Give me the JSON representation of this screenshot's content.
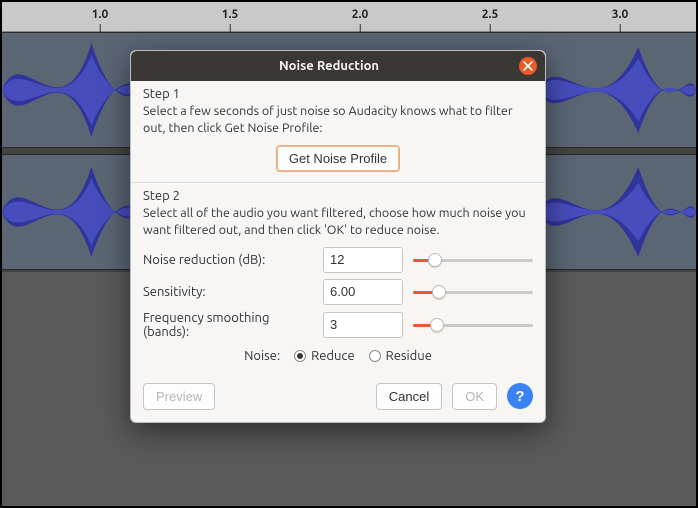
{
  "ruler": {
    "ticks": [
      "1.0",
      "1.5",
      "2.0",
      "2.5",
      "3.0"
    ]
  },
  "dialog": {
    "title": "Noise Reduction",
    "step1": {
      "heading": "Step 1",
      "desc": "Select a few seconds of just noise so Audacity knows what to filter out, then click Get Noise Profile:",
      "get_profile_label": "Get Noise Profile"
    },
    "step2": {
      "heading": "Step 2",
      "desc": "Select all of the audio you want filtered, choose how much noise you want filtered out, and then click 'OK' to reduce noise.",
      "params": {
        "noise_reduction": {
          "label": "Noise reduction (dB):",
          "value": "12",
          "slider_pct": 18
        },
        "sensitivity": {
          "label": "Sensitivity:",
          "value": "6.00",
          "slider_pct": 22
        },
        "freq_smoothing": {
          "label": "Frequency smoothing (bands):",
          "value": "3",
          "slider_pct": 20
        }
      },
      "noise_label": "Noise:",
      "radio": {
        "reduce": "Reduce",
        "residue": "Residue",
        "selected": "reduce"
      }
    },
    "footer": {
      "preview": "Preview",
      "cancel": "Cancel",
      "ok": "OK",
      "help": "?"
    }
  }
}
